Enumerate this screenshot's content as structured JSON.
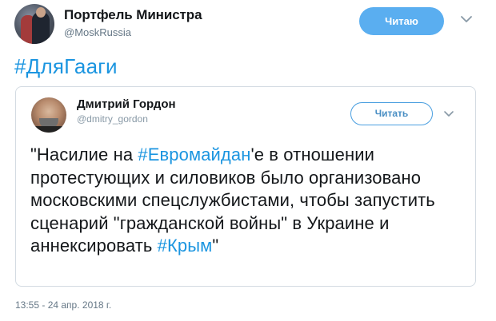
{
  "tweet": {
    "author_name": "Портфель Министра",
    "author_handle": "@MoskRussia",
    "follow_label": "Читаю",
    "hashtag": "#ДляГааги",
    "timestamp": "13:55 - 24 апр. 2018 г."
  },
  "quoted": {
    "author_name": "Дмитрий Гордон",
    "author_handle": "@dmitry_gordon",
    "follow_label": "Читать",
    "text_parts": {
      "p1": "\"Насилие на ",
      "tag1": "#Евромайдан",
      "p2": "'е в отношении протестующих и силовиков было организовано московскими спецслужбистами, чтобы запустить сценарий \"гражданской войны\" в Украине и аннексировать ",
      "tag2": "#Крым",
      "p3": "\""
    }
  },
  "colors": {
    "accent": "#1b95e0",
    "follow_bg": "#5aaef0",
    "muted": "#657786",
    "border": "#d3dbe2"
  },
  "icons": {
    "more": "chevron-down-icon",
    "quoted_more": "chevron-down-icon"
  }
}
